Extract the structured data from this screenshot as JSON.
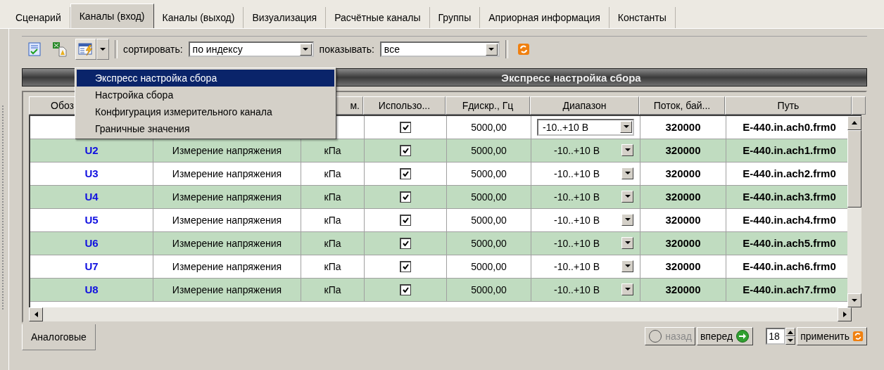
{
  "tabs": [
    {
      "label": "Сценарий",
      "selected": false
    },
    {
      "label": "Каналы (вход)",
      "selected": true
    },
    {
      "label": "Каналы (выход)",
      "selected": false
    },
    {
      "label": "Визуализация",
      "selected": false
    },
    {
      "label": "Расчётные каналы",
      "selected": false
    },
    {
      "label": "Группы",
      "selected": false
    },
    {
      "label": "Априорная информация",
      "selected": false
    },
    {
      "label": "Константы",
      "selected": false
    }
  ],
  "toolbar": {
    "sort_label": "сортировать:",
    "sort_value": "по индексу",
    "show_label": "показывать:",
    "show_value": "все"
  },
  "menu": [
    {
      "label": "Экспресс настройка сбора",
      "selected": true
    },
    {
      "label": "Настройка сбора",
      "selected": false
    },
    {
      "label": "Конфигурация измерительного канала",
      "selected": false
    },
    {
      "label": "Граничные значения",
      "selected": false
    }
  ],
  "panel_title": "Экспресс настройка сбора",
  "table": {
    "columns": [
      "Обоз",
      null,
      "м.",
      "Использо...",
      "Fдискр., Гц",
      "Диапазон",
      "Поток, бай...",
      "Путь"
    ],
    "rows": [
      {
        "used": true,
        "rate": "5000,00",
        "range": "-10..+10 В",
        "editing": true,
        "stream": "320000",
        "path": "E-440.in.ach0.frm0"
      },
      {
        "id": "U2",
        "name": "Измерение напряжения",
        "unit": "кПа",
        "used": true,
        "rate": "5000,00",
        "range": "-10..+10 В",
        "editing": false,
        "stream": "320000",
        "path": "E-440.in.ach1.frm0"
      },
      {
        "id": "U3",
        "name": "Измерение напряжения",
        "unit": "кПа",
        "used": true,
        "rate": "5000,00",
        "range": "-10..+10 В",
        "editing": false,
        "stream": "320000",
        "path": "E-440.in.ach2.frm0"
      },
      {
        "id": "U4",
        "name": "Измерение напряжения",
        "unit": "кПа",
        "used": true,
        "rate": "5000,00",
        "range": "-10..+10 В",
        "editing": false,
        "stream": "320000",
        "path": "E-440.in.ach3.frm0"
      },
      {
        "id": "U5",
        "name": "Измерение напряжения",
        "unit": "кПа",
        "used": true,
        "rate": "5000,00",
        "range": "-10..+10 В",
        "editing": false,
        "stream": "320000",
        "path": "E-440.in.ach4.frm0"
      },
      {
        "id": "U6",
        "name": "Измерение напряжения",
        "unit": "кПа",
        "used": true,
        "rate": "5000,00",
        "range": "-10..+10 В",
        "editing": false,
        "stream": "320000",
        "path": "E-440.in.ach5.frm0"
      },
      {
        "id": "U7",
        "name": "Измерение напряжения",
        "unit": "кПа",
        "used": true,
        "rate": "5000,00",
        "range": "-10..+10 В",
        "editing": false,
        "stream": "320000",
        "path": "E-440.in.ach6.frm0"
      },
      {
        "id": "U8",
        "name": "Измерение напряжения",
        "unit": "кПа",
        "used": true,
        "rate": "5000,00",
        "range": "-10..+10 В",
        "editing": false,
        "stream": "320000",
        "path": "E-440.in.ach7.frm0"
      }
    ]
  },
  "bottom_tabs": [
    {
      "label": "Аналоговые",
      "selected": true
    }
  ],
  "pager": {
    "back": {
      "label": "назад",
      "disabled": true
    },
    "forward": {
      "label": "вперед",
      "disabled": false
    },
    "count": "18",
    "apply": "применить"
  }
}
